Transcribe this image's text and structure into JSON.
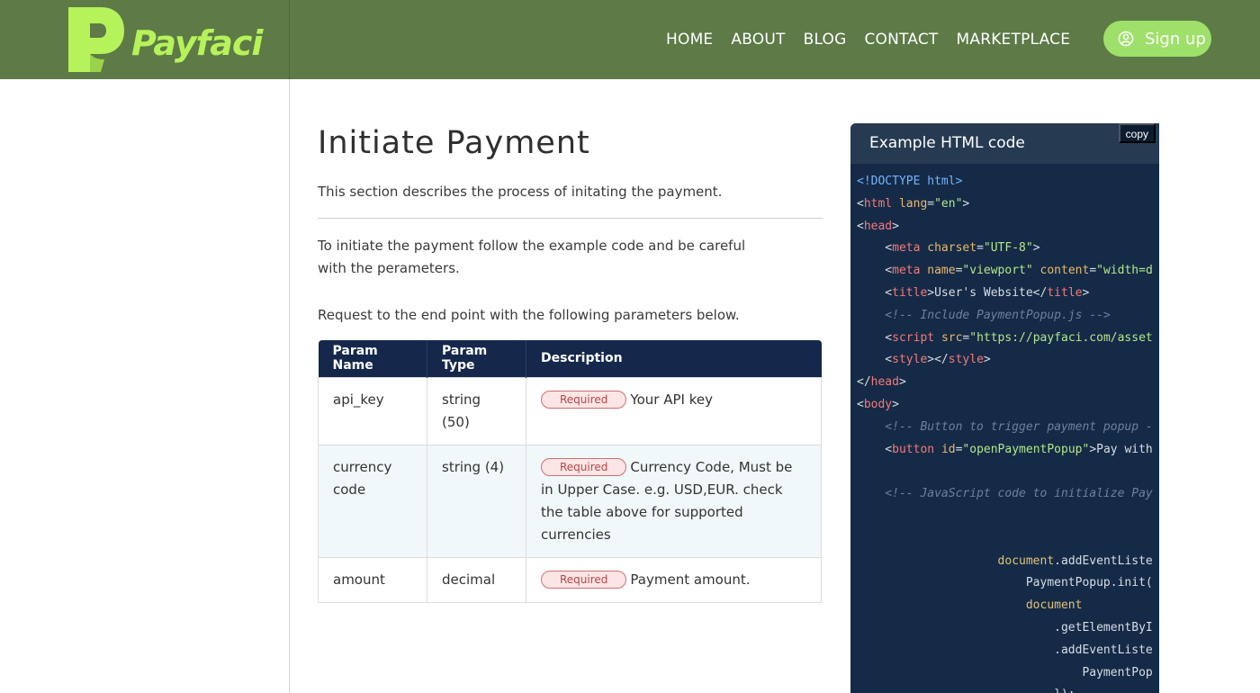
{
  "brand": {
    "name": "Payfaci",
    "logo_color": "#b6f25a",
    "header_color": "#5d7a47"
  },
  "nav": {
    "items": [
      "HOME",
      "ABOUT",
      "BLOG",
      "CONTACT",
      "MARKETPLACE"
    ],
    "signup_label": "Sign up",
    "signup_icon": "user-circle-icon"
  },
  "main": {
    "title": "Initiate Payment",
    "intro": "This section describes the process of initating the payment.",
    "paragraph": "To initiate the payment follow the example code and be careful with the perameters.",
    "request_text": "Request to the end point with the following parameters below."
  },
  "params_table": {
    "headers": [
      "Param Name",
      "Param Type",
      "Description"
    ],
    "badge_label": "Required",
    "rows": [
      {
        "name": "api_key",
        "type": "string (50)",
        "description": "Your API key"
      },
      {
        "name": "currency code",
        "type": "string (4)",
        "description": "Currency Code, Must be in Upper Case. e.g. USD,EUR. check the table above for supported currencies"
      },
      {
        "name": "amount",
        "type": "decimal",
        "description": "Payment amount."
      }
    ]
  },
  "code_panel": {
    "title": "Example HTML code",
    "copy_label": "copy",
    "lines": [
      "<!DOCTYPE html>",
      "<html lang=\"en\">",
      "<head>",
      "    <meta charset=\"UTF-8\">",
      "    <meta name=\"viewport\" content=\"width=d",
      "    <title>User's Website</title>",
      "    <!-- Include PaymentPopup.js -->",
      "    <script src=\"https://payfaci.com/asset",
      "    <style></style>",
      "</head>",
      "<body>",
      "    <!-- Button to trigger payment popup -",
      "    <button id=\"openPaymentPopup\">Pay with",
      "",
      "    <!-- JavaScript code to initialize Pay",
      "",
      "",
      "                    document.addEventListe",
      "                        PaymentPopup.init(",
      "                        document",
      "                            .getElementByI",
      "                            .addEventListe",
      "                                PaymentPop",
      "                            });"
    ]
  }
}
